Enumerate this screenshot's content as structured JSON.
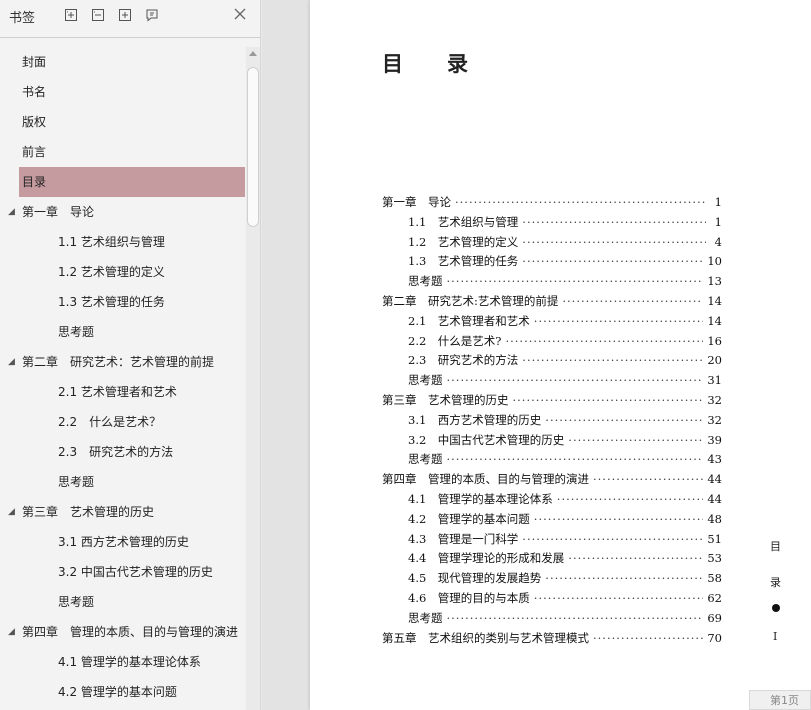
{
  "sidebar": {
    "title": "书签",
    "toolbar_icons": [
      "expand-all-icon",
      "collapse-all-icon",
      "add-bookmark-icon",
      "bookmark-options-icon"
    ],
    "close_icon": "close-icon",
    "items": [
      {
        "label": "封面",
        "level": 0,
        "expandable": false,
        "selected": false
      },
      {
        "label": "书名",
        "level": 0,
        "expandable": false,
        "selected": false
      },
      {
        "label": "版权",
        "level": 0,
        "expandable": false,
        "selected": false
      },
      {
        "label": "前言",
        "level": 0,
        "expandable": false,
        "selected": false
      },
      {
        "label": "目录",
        "level": 0,
        "expandable": false,
        "selected": true
      },
      {
        "label": "第一章　导论",
        "level": 0,
        "expandable": true,
        "selected": false
      },
      {
        "label": "1.1  艺术组织与管理",
        "level": 1,
        "expandable": false,
        "selected": false
      },
      {
        "label": "1.2  艺术管理的定义",
        "level": 1,
        "expandable": false,
        "selected": false
      },
      {
        "label": "1.3  艺术管理的任务",
        "level": 1,
        "expandable": false,
        "selected": false
      },
      {
        "label": "思考题",
        "level": 1,
        "expandable": false,
        "selected": false
      },
      {
        "label": "第二章　研究艺术：艺术管理的前提",
        "level": 0,
        "expandable": true,
        "selected": false
      },
      {
        "label": "2.1  艺术管理者和艺术",
        "level": 1,
        "expandable": false,
        "selected": false
      },
      {
        "label": "2.2　什么是艺术？",
        "level": 1,
        "expandable": false,
        "selected": false
      },
      {
        "label": "2.3　研究艺术的方法",
        "level": 1,
        "expandable": false,
        "selected": false
      },
      {
        "label": "思考题",
        "level": 1,
        "expandable": false,
        "selected": false
      },
      {
        "label": "第三章　艺术管理的历史",
        "level": 0,
        "expandable": true,
        "selected": false
      },
      {
        "label": "3.1  西方艺术管理的历史",
        "level": 1,
        "expandable": false,
        "selected": false
      },
      {
        "label": "3.2  中国古代艺术管理的历史",
        "level": 1,
        "expandable": false,
        "selected": false
      },
      {
        "label": "思考题",
        "level": 1,
        "expandable": false,
        "selected": false
      },
      {
        "label": "第四章　管理的本质、目的与管理的演进",
        "level": 0,
        "expandable": true,
        "selected": false
      },
      {
        "label": "4.1  管理学的基本理论体系",
        "level": 1,
        "expandable": false,
        "selected": false
      },
      {
        "label": "4.2  管理学的基本问题",
        "level": 1,
        "expandable": false,
        "selected": false
      }
    ]
  },
  "page": {
    "heading_char1": "目",
    "heading_char2": "录",
    "toc": [
      {
        "title": "第一章　导论",
        "page": "1",
        "sub": false
      },
      {
        "title": "1.1　艺术组织与管理",
        "page": "1",
        "sub": true
      },
      {
        "title": "1.2　艺术管理的定义",
        "page": "4",
        "sub": true
      },
      {
        "title": "1.3　艺术管理的任务",
        "page": "10",
        "sub": true
      },
      {
        "title": "思考题",
        "page": "13",
        "sub": true
      },
      {
        "title": "第二章　研究艺术:艺术管理的前提",
        "page": "14",
        "sub": false
      },
      {
        "title": "2.1　艺术管理者和艺术",
        "page": "14",
        "sub": true
      },
      {
        "title": "2.2　什么是艺术?",
        "page": "16",
        "sub": true
      },
      {
        "title": "2.3　研究艺术的方法",
        "page": "20",
        "sub": true
      },
      {
        "title": "思考题",
        "page": "31",
        "sub": true
      },
      {
        "title": "第三章　艺术管理的历史",
        "page": "32",
        "sub": false
      },
      {
        "title": "3.1　西方艺术管理的历史",
        "page": "32",
        "sub": true
      },
      {
        "title": "3.2　中国古代艺术管理的历史",
        "page": "39",
        "sub": true
      },
      {
        "title": "思考题",
        "page": "43",
        "sub": true
      },
      {
        "title": "第四章　管理的本质、目的与管理的演进",
        "page": "44",
        "sub": false
      },
      {
        "title": "4.1　管理学的基本理论体系",
        "page": "44",
        "sub": true
      },
      {
        "title": "4.2　管理学的基本问题",
        "page": "48",
        "sub": true
      },
      {
        "title": "4.3　管理是一门科学",
        "page": "51",
        "sub": true
      },
      {
        "title": "4.4　管理学理论的形成和发展",
        "page": "53",
        "sub": true
      },
      {
        "title": "4.5　现代管理的发展趋势",
        "page": "58",
        "sub": true
      },
      {
        "title": "4.6　管理的目的与本质",
        "page": "62",
        "sub": true
      },
      {
        "title": "思考题",
        "page": "69",
        "sub": true
      },
      {
        "title": "第五章　艺术组织的类别与艺术管理模式",
        "page": "70",
        "sub": false
      }
    ],
    "side_mark_1": "目",
    "side_mark_2": "录",
    "side_mark_roman": "I"
  },
  "page_indicator": "第1页",
  "colors": {
    "selected_bookmark": "#c69ba0",
    "sidebar_bg": "#f3f3f3",
    "viewport_bg": "#e3e3e3"
  }
}
